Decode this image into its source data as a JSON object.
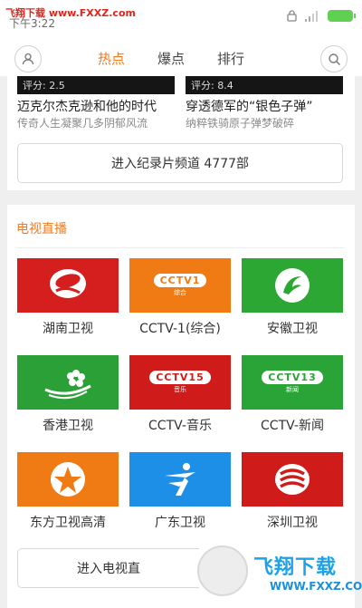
{
  "status_bar": {
    "watermark": "飞翔下载 www.FXXZ.com",
    "time": "下午3:22"
  },
  "header": {
    "tabs": [
      {
        "label": "热点",
        "active": true
      },
      {
        "label": "爆点",
        "active": false
      },
      {
        "label": "排行",
        "active": false
      }
    ]
  },
  "movies": [
    {
      "rating": "评分: 2.5",
      "title": "迈克尔杰克逊和他的时代",
      "subtitle": "传奇人生凝聚几多阴郁风流"
    },
    {
      "rating": "评分: 8.4",
      "title": "穿透德军的“银色子弹”",
      "subtitle": "纳粹铁骑原子弹梦破碎"
    }
  ],
  "documentary_button": "进入纪录片频道 4777部",
  "tv_section": {
    "title": "电视直播",
    "channels": [
      {
        "name": "湖南卫视",
        "color": "#d51f1f",
        "logo": "hunan-logo-icon"
      },
      {
        "name": "CCTV-1(综合)",
        "color": "#f07b14",
        "logo_text": "CCTV1",
        "logo_sub": "综合"
      },
      {
        "name": "安徽卫视",
        "color": "#2da733",
        "logo": "anhui-logo-icon"
      },
      {
        "name": "香港卫视",
        "color": "#2aa037",
        "logo": "hongkong-logo-icon"
      },
      {
        "name": "CCTV-音乐",
        "color": "#d01b1b",
        "logo_text": "CCTV15",
        "logo_sub": "音乐"
      },
      {
        "name": "CCTV-新闻",
        "color": "#2ba437",
        "logo_text": "CCTV13",
        "logo_sub": "新闻"
      },
      {
        "name": "东方卫视高清",
        "color": "#f07b14",
        "logo": "dongfang-logo-icon"
      },
      {
        "name": "广东卫视",
        "color": "#1e8fe6",
        "logo": "guangdong-logo-icon"
      },
      {
        "name": "深圳卫视",
        "color": "#d01b1b",
        "logo": "shenzhen-logo-icon"
      }
    ]
  },
  "tv_button": "进入电视直",
  "watermark_bottom": {
    "text": "飞翔下载",
    "url": "WWW.FXXZ.COM"
  }
}
